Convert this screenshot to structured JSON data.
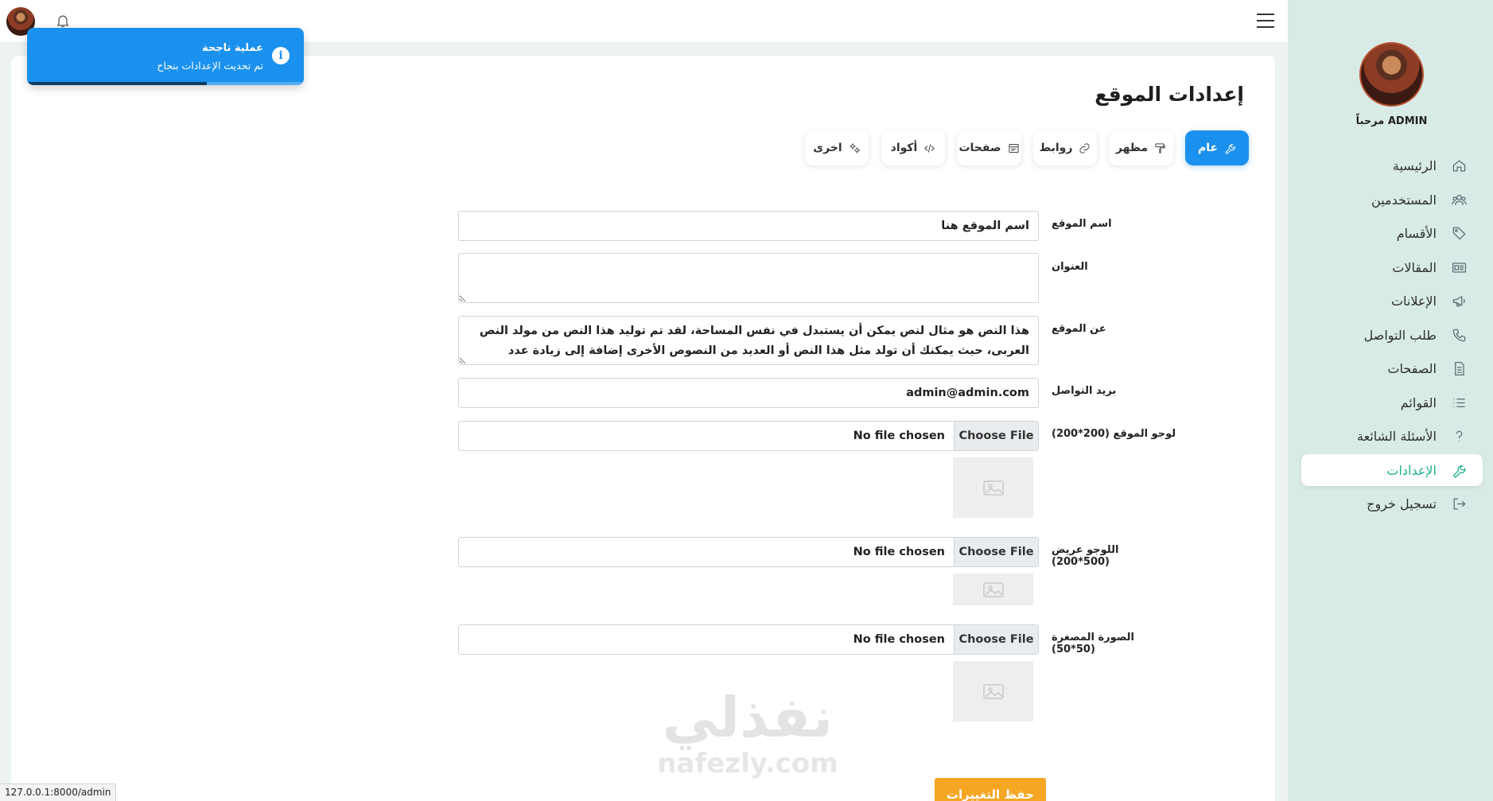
{
  "topbar": {
    "menu_icon": "hamburger-icon",
    "bell_icon": "bell-icon"
  },
  "toast": {
    "title": "عملية ناجحة",
    "message": "تم تحديث الإعدادات بنجاح",
    "icon": "info-icon",
    "progress": 0.65,
    "color": "#1a91ee"
  },
  "sidebar": {
    "welcome": "مرحباً ADMIN",
    "items": [
      {
        "label": "الرئيسية",
        "icon": "home-icon"
      },
      {
        "label": "المستخدمين",
        "icon": "users-icon"
      },
      {
        "label": "الأقسام",
        "icon": "tag-icon"
      },
      {
        "label": "المقالات",
        "icon": "newspaper-icon"
      },
      {
        "label": "الإعلانات",
        "icon": "megaphone-icon"
      },
      {
        "label": "طلب التواصل",
        "icon": "phone-icon"
      },
      {
        "label": "الصفحات",
        "icon": "document-icon"
      },
      {
        "label": "القوائم",
        "icon": "list-icon"
      },
      {
        "label": "الأسئلة الشائعة",
        "icon": "question-icon"
      },
      {
        "label": "الإعدادات",
        "icon": "wrench-icon",
        "active": true
      },
      {
        "label": "تسجيل خروج",
        "icon": "logout-icon"
      }
    ],
    "active_color": "#23b38f"
  },
  "page": {
    "title": "إعدادات الموقع"
  },
  "tabs": [
    {
      "label": "عام",
      "icon": "wrench-icon",
      "active": true
    },
    {
      "label": "مظهر",
      "icon": "paint-roller-icon"
    },
    {
      "label": "روابط",
      "icon": "link-icon"
    },
    {
      "label": "صفحات",
      "icon": "browser-icon"
    },
    {
      "label": "أكواد",
      "icon": "code-icon"
    },
    {
      "label": "اخرى",
      "icon": "gears-icon"
    }
  ],
  "form": {
    "site_name": {
      "label": "اسم الموقع",
      "value": "اسم الموقع هنا"
    },
    "address": {
      "label": "العنوان",
      "value": ""
    },
    "about": {
      "label": "عن الموقع",
      "value": "هذا النص هو مثال لنص يمكن أن يستبدل في نفس المساحة، لقد تم توليد هذا النص من مولد النص العربى، حيث يمكنك أن تولد مثل هذا النص أو العديد من النصوص الأخرى إضافة إلى زيادة عدد الحروف التى يولدها التطبيق"
    },
    "email": {
      "label": "بريد التواصل",
      "value": "admin@admin.com"
    },
    "logo": {
      "label": "لوجو الموقع (200*200)",
      "button": "Choose File",
      "status": "No file chosen"
    },
    "wide_logo": {
      "label": "اللوجو عريض (500*200)",
      "button": "Choose File",
      "status": "No file chosen"
    },
    "favicon": {
      "label": "الصورة المصغرة (50*50)",
      "button": "Choose File",
      "status": "No file chosen"
    },
    "save_label": "حفظ التغييرات"
  },
  "watermark": {
    "arabic": "نفذلي",
    "latin": "nafezly.com"
  },
  "status_url": "127.0.0.1:8000/admin"
}
